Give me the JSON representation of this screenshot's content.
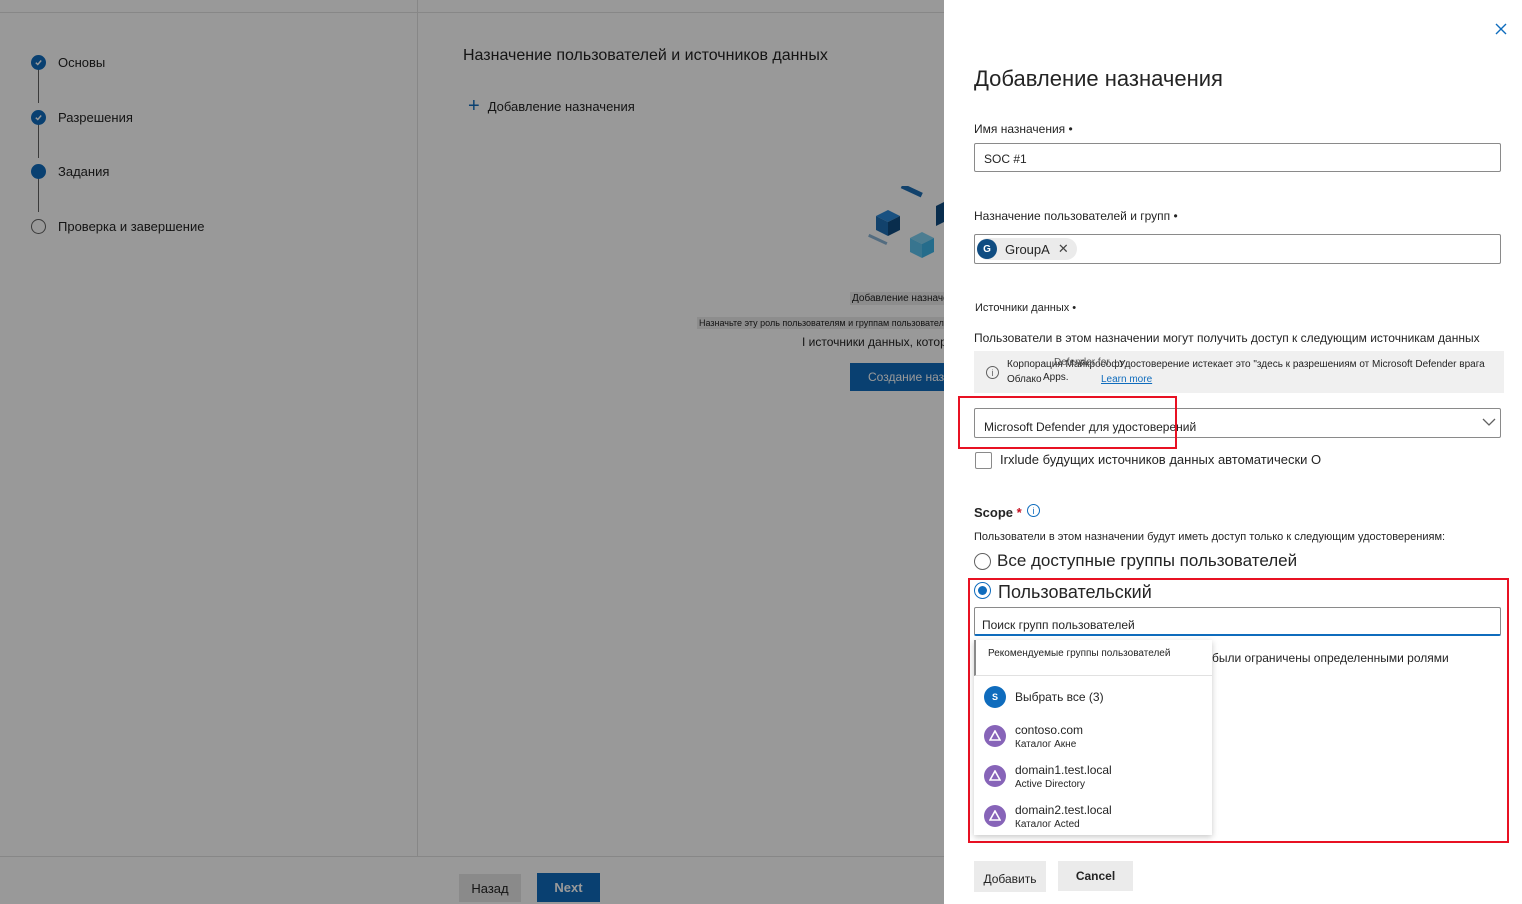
{
  "wizard": {
    "steps": [
      {
        "label": "Основы",
        "state": "done"
      },
      {
        "label": "Разрешения",
        "state": "done"
      },
      {
        "label": "Задания",
        "state": "current"
      },
      {
        "label": "Проверка и завершение",
        "state": "todo"
      }
    ],
    "main_title": "Назначение пользователей и источников данных",
    "add_assignment": "Добавление назначения",
    "empty_state": {
      "title": "Добавление назначения",
      "description_line1": "Назначьте эту роль пользователям и группам пользователей",
      "description_line2": "I источники данных, которые",
      "create_button": "Создание назначения"
    },
    "back_button": "Назад",
    "next_button": "Next"
  },
  "panel": {
    "title": "Добавление назначения",
    "assignment_name": {
      "label": "Имя назначения •",
      "value": "SOC #1"
    },
    "users_groups": {
      "label": "Назначение пользователей и групп •",
      "chip_initial": "G",
      "chip_label": "GroupA",
      "chip_remove": "✕"
    },
    "data_sources": {
      "label": "Источники данных •",
      "description": "Пользователи в этом назначении могут получить доступ к следующим источникам данных",
      "info_line1": "Корпорация Майкрософт",
      "info_line2": "Облако",
      "info_overlap": "Defender for",
      "info_apps": "Apps.",
      "info_line3": "Удостоверение истекает это \"здесь к разрешениям от Microsoft Defender врага",
      "learn_more": "Learn more",
      "selected": "Microsoft Defender для удостоверений",
      "include_future": "Irxlude будущих источников данных автоматически О"
    },
    "scope": {
      "label": "Scope",
      "required_mark": "*",
      "info_glyph": "i",
      "description": "Пользователи в этом назначении будут иметь доступ только к следующим удостоверениям:",
      "option_all": "Все доступные группы пользователей",
      "option_custom": "Пользовательский",
      "selected_option": "custom",
      "search_placeholder": "Поиск групп пользователей",
      "behind_text": "были ограничены определенными ролями",
      "suggestions_header": "Рекомендуемые группы пользователей",
      "suggestions": [
        {
          "initial": "S",
          "name": "Выбрать все (3)",
          "sub": "",
          "avatar": "blue"
        },
        {
          "initial": "",
          "name": "contoso.com",
          "sub": "Каталог Акне",
          "avatar": "purple"
        },
        {
          "initial": "",
          "name": "domain1.test.local",
          "sub": "Active Directory",
          "avatar": "purple"
        },
        {
          "initial": "",
          "name": "domain2.test.local",
          "sub": "Каталог Acted",
          "avatar": "purple"
        }
      ]
    },
    "add_button": "Добавить",
    "cancel_button": "Cancel"
  },
  "colors": {
    "accent": "#0f6cbd",
    "highlight": "#e81123",
    "group_avatar": "#8764b8"
  }
}
